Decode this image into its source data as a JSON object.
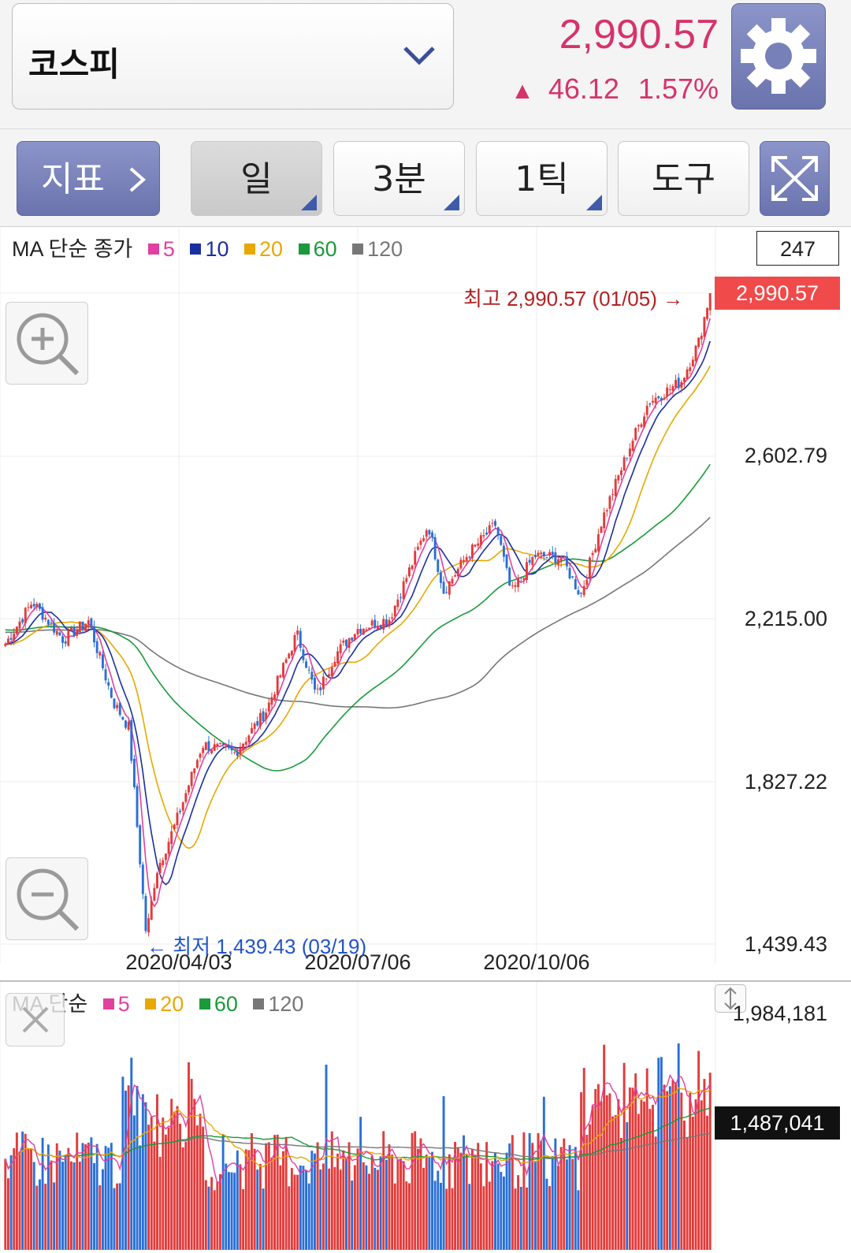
{
  "header": {
    "market": "코스피",
    "price": "2,990.57",
    "change_arrow": "▲",
    "change": "46.12",
    "change_pct": "1.57%",
    "up_color": "#d6336c",
    "settings_icon": "gear-icon"
  },
  "toolbar": {
    "indicator_label": "지표",
    "period_day": "일",
    "period_min": "3분",
    "period_tick": "1틱",
    "tools_label": "도구",
    "expand_icon": "expand-icon"
  },
  "price_chart": {
    "legend_title": "MA 단순 종가",
    "ma": [
      {
        "label": "5",
        "color": "#e040a0"
      },
      {
        "label": "10",
        "color": "#1a2fa0"
      },
      {
        "label": "20",
        "color": "#e8a800"
      },
      {
        "label": "60",
        "color": "#1a9a3a"
      },
      {
        "label": "120",
        "color": "#777777"
      }
    ],
    "candle_count": "247",
    "y_labels": [
      "2,602.79",
      "2,215.00",
      "1,827.22",
      "1,439.43"
    ],
    "x_labels": [
      "2020/04/03",
      "2020/07/06",
      "2020/10/06"
    ],
    "current_badge": "2,990.57",
    "high_note": "최고 2,990.57 (01/05) →",
    "low_note": "← 최저 1,439.43 (03/19)"
  },
  "volume_chart": {
    "legend_title": "MA 단순",
    "ma": [
      {
        "label": "5",
        "color": "#e040a0"
      },
      {
        "label": "20",
        "color": "#e8a800"
      },
      {
        "label": "60",
        "color": "#1a9a3a"
      },
      {
        "label": "120",
        "color": "#777777"
      }
    ],
    "max_label": "1,984,181",
    "current_badge": "1,487,041"
  },
  "chart_data": {
    "type": "candlestick",
    "ylim": [
      1439.43,
      2990.57
    ],
    "high": 2990.57,
    "low": 1439.43,
    "close_path": [
      [
        "2020-01-06",
        2155
      ],
      [
        "2020-01-20",
        2255
      ],
      [
        "2020-02-05",
        2165
      ],
      [
        "2020-02-18",
        2210
      ],
      [
        "2020-03-02",
        2015
      ],
      [
        "2020-03-10",
        1955
      ],
      [
        "2020-03-19",
        1457
      ],
      [
        "2020-03-24",
        1610
      ],
      [
        "2020-04-03",
        1725
      ],
      [
        "2020-04-17",
        1915
      ],
      [
        "2020-05-04",
        1895
      ],
      [
        "2020-05-20",
        1995
      ],
      [
        "2020-06-05",
        2180
      ],
      [
        "2020-06-15",
        2030
      ],
      [
        "2020-06-25",
        2130
      ],
      [
        "2020-07-06",
        2190
      ],
      [
        "2020-07-23",
        2215
      ],
      [
        "2020-08-12",
        2440
      ],
      [
        "2020-08-20",
        2280
      ],
      [
        "2020-09-01",
        2365
      ],
      [
        "2020-09-16",
        2440
      ],
      [
        "2020-09-24",
        2275
      ],
      [
        "2020-10-06",
        2365
      ],
      [
        "2020-10-20",
        2360
      ],
      [
        "2020-10-30",
        2270
      ],
      [
        "2020-11-10",
        2450
      ],
      [
        "2020-11-24",
        2620
      ],
      [
        "2020-12-04",
        2730
      ],
      [
        "2020-12-21",
        2780
      ],
      [
        "2020-12-30",
        2873
      ],
      [
        "2021-01-05",
        2990.57
      ]
    ],
    "volume": {
      "max": 1984181,
      "current": 1487041
    }
  }
}
